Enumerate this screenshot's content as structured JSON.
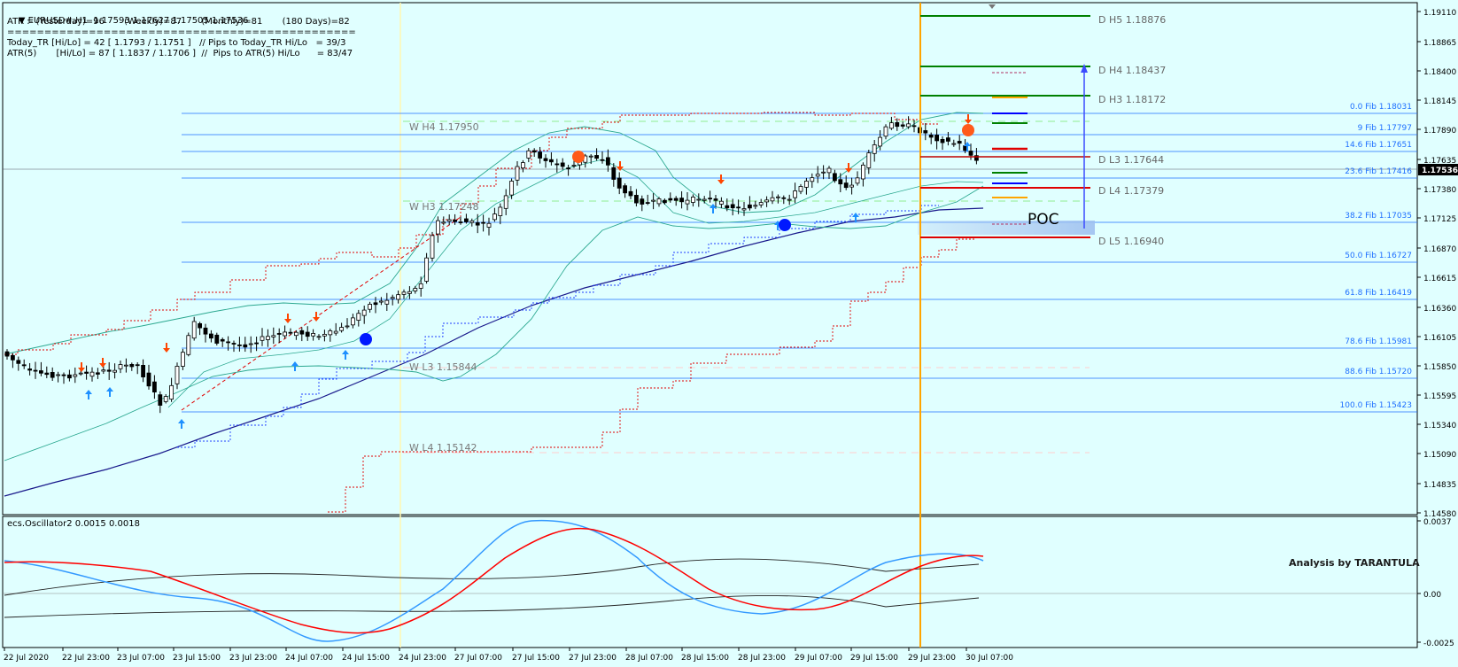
{
  "header": {
    "symbol_line": "EURUSD#,H1  1.17593 1.17627 1.17505 1.17536",
    "atr_line": "ATR :- (Yesterday)=96       (Weekly)=87       (Monthly)=81       (180 Days)=82",
    "separator": "===============================================",
    "today_tr_line": "Today_TR [Hi/Lo] = 42 [ 1.1793 / 1.1751 ]   // Pips to Today_TR Hi/Lo   = 39/3",
    "atr5_line": "ATR(5)       [Hi/Lo] = 87 [ 1.1837 / 1.1706 ]  //  Pips to ATR(5) Hi/Lo      = 83/47"
  },
  "colors": {
    "background": "#e0ffff",
    "candle": "#000000",
    "fib_line": "#1e6fff",
    "daily_pivot_green": "#008000",
    "daily_pivot_red": "#e00000",
    "period_separator": "#ffa500",
    "up_arrow": "#1e90ff",
    "down_arrow": "#ff4500",
    "bollinger": "#2ba890",
    "moving_average": "#1a1a8c",
    "oscillator_blue": "#3399ff",
    "oscillator_red": "#ff0000"
  },
  "price_axis": {
    "ticks": [
      "1.19110",
      "1.18865",
      "1.18400",
      "1.18145",
      "1.17890",
      "1.17635",
      "1.17380",
      "1.17125",
      "1.16870",
      "1.16615",
      "1.16360",
      "1.16105",
      "1.15850",
      "1.15595",
      "1.15340",
      "1.15090",
      "1.14835",
      "1.14580"
    ],
    "current_price": "1.17536"
  },
  "daily_pivots": [
    {
      "label": "D  H5 1.18876"
    },
    {
      "label": "D  H4 1.18437"
    },
    {
      "label": "D  H3 1.18172"
    },
    {
      "label": "D  L3 1.17644"
    },
    {
      "label": "D  L4 1.17379"
    },
    {
      "label": "D  L5 1.16940"
    }
  ],
  "weekly_pivots": [
    {
      "label": "W  H4 1.17950"
    },
    {
      "label": "W  H3 1.17248"
    },
    {
      "label": "W  L3 1.15844"
    },
    {
      "label": "W  L4 1.15142"
    }
  ],
  "fib_levels": [
    {
      "label": "0.0 Fib 1.18031"
    },
    {
      "label": "9 Fib 1.17797"
    },
    {
      "label": "14.6 Fib 1.17651"
    },
    {
      "label": "23.6 Fib 1.17416"
    },
    {
      "label": "38.2 Fib 1.17035"
    },
    {
      "label": "50.0 Fib 1.16727"
    },
    {
      "label": "61.8 Fib 1.16419"
    },
    {
      "label": "78.6 Fib 1.15981"
    },
    {
      "label": "88.6 Fib 1.15720"
    },
    {
      "label": "100.0 Fib 1.15423"
    }
  ],
  "poc_label": "POC",
  "oscillator": {
    "title": "ecs.Oscillator2 0.0015 0.0018",
    "ticks": [
      "0.0037",
      "0.00",
      "-0.0025"
    ],
    "watermark": "Analysis by TARANTULA"
  },
  "time_axis": [
    "22 Jul 2020",
    "22 Jul 23:00",
    "23 Jul 07:00",
    "23 Jul 15:00",
    "23 Jul 23:00",
    "24 Jul 07:00",
    "24 Jul 15:00",
    "24 Jul 23:00",
    "27 Jul 07:00",
    "27 Jul 15:00",
    "27 Jul 23:00",
    "28 Jul 07:00",
    "28 Jul 15:00",
    "28 Jul 23:00",
    "29 Jul 07:00",
    "29 Jul 15:00",
    "29 Jul 23:00",
    "30 Jul 07:00"
  ]
}
